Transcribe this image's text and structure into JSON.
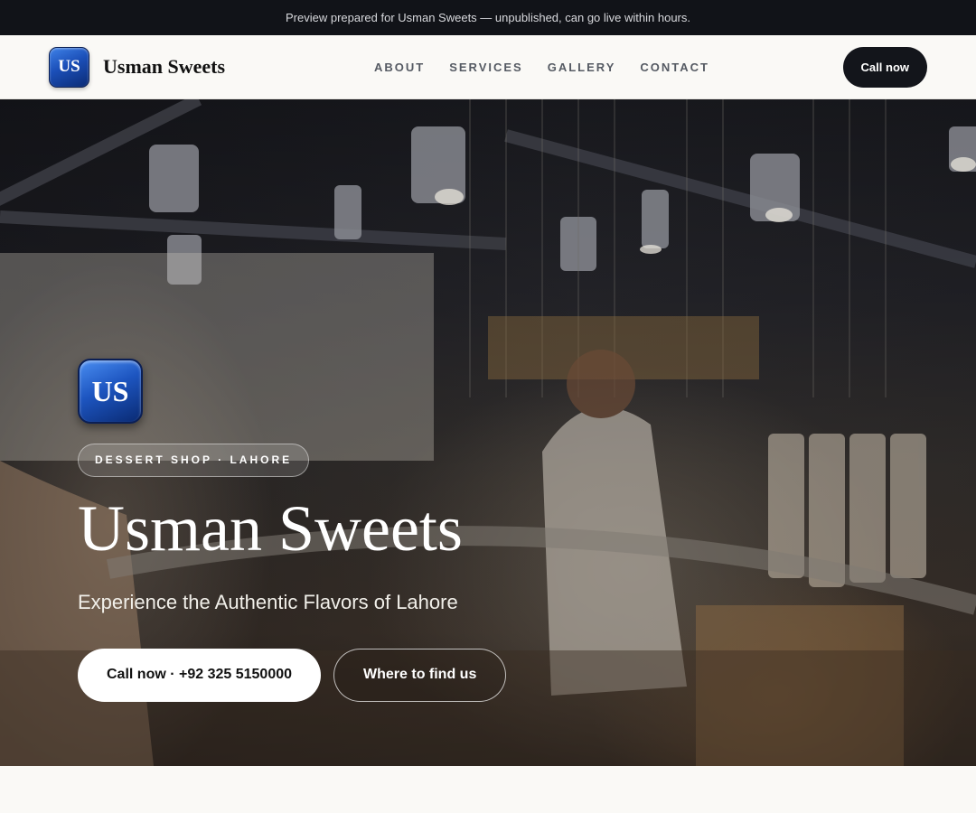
{
  "banner": {
    "text": "Preview prepared for Usman Sweets — unpublished, can go live within hours."
  },
  "nav": {
    "logo_text": "US",
    "brand_name": "Usman Sweets",
    "links": [
      "ABOUT",
      "SERVICES",
      "GALLERY",
      "CONTACT"
    ],
    "cta_label": "Call now"
  },
  "hero": {
    "logo_text": "US",
    "tag": "DESSERT SHOP · LAHORE",
    "title": "Usman Sweets",
    "subtitle": "Experience the Authentic Flavors of Lahore",
    "primary_cta": "Call now · +92 325 5150000",
    "secondary_cta": "Where to find us"
  },
  "colors": {
    "banner_bg": "#111318",
    "logo_blue": "#1b4fb8",
    "nav_cta_bg": "#13151b",
    "page_bg": "#faf9f6"
  }
}
